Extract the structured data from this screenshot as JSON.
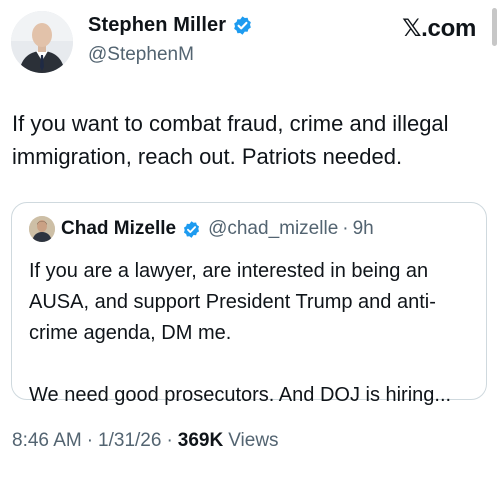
{
  "author": {
    "name": "Stephen Miller",
    "handle": "@StephenM",
    "verified": true,
    "avatar_icon": "person-avatar"
  },
  "brand": {
    "x": "𝕏",
    "domain": ".com"
  },
  "tweet": {
    "text": "If you want to combat fraud, crime and illegal immigration, reach out. Patriots needed."
  },
  "quoted": {
    "name": "Chad Mizelle",
    "handle": "@chad_mizelle",
    "separator": "·",
    "time": "9h",
    "verified": true,
    "paragraphs": [
      "If you are a lawyer, are interested in being an AUSA, and support President Trump and anti-crime agenda, DM me.",
      "We need good prosecutors. And DOJ is hiring..."
    ]
  },
  "meta": {
    "time": "8:46 AM",
    "date": "1/31/26",
    "separator": "·",
    "views_count": "369K",
    "views_label": "Views"
  },
  "colors": {
    "text": "#0f1419",
    "secondary": "#536471",
    "verified_blue": "#1d9bf0",
    "border": "#cfd9de"
  }
}
